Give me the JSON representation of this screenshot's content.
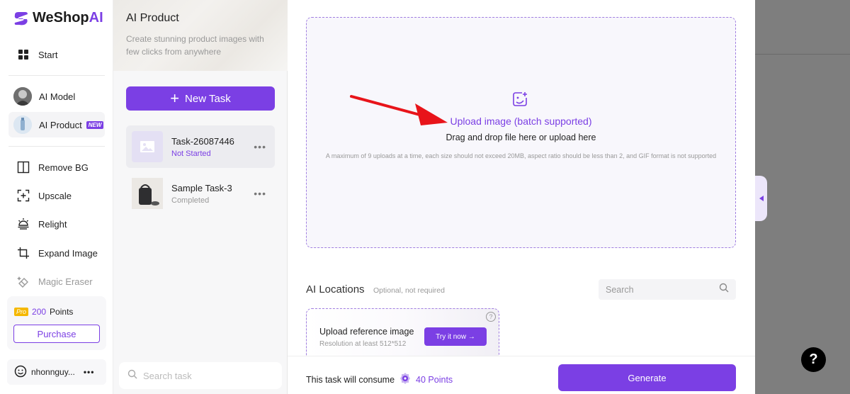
{
  "app": {
    "logo_text": "WeShop",
    "logo_ai": "AI"
  },
  "nav": {
    "start": "Start",
    "ai_model": "AI Model",
    "ai_product": "AI Product",
    "new_badge": "NEW",
    "remove_bg": "Remove BG",
    "upscale": "Upscale",
    "relight": "Relight",
    "expand_image": "Expand Image",
    "magic_eraser": "Magic Eraser"
  },
  "points": {
    "badge": "Pro",
    "amount": "200",
    "unit": "Points",
    "purchase": "Purchase"
  },
  "user": {
    "name": "nhonnguy...",
    "more": "•••"
  },
  "panel": {
    "title": "AI Product",
    "subtitle": "Create stunning product images with few clicks from anywhere",
    "new_task": "New Task",
    "tasks": [
      {
        "name": "Task-26087446",
        "status": "Not Started",
        "status_color": "#7b3fe4"
      },
      {
        "name": "Sample Task-3",
        "status": "Completed",
        "status_color": "#999999"
      }
    ],
    "search_placeholder": "Search task"
  },
  "upload": {
    "title": "Upload image (batch supported)",
    "subtitle": "Drag and drop file here or upload here",
    "note": "A maximum of 9 uploads at a time, each size should not exceed 20MB, aspect ratio should be less than 2, and GIF format is not supported"
  },
  "locations": {
    "title": "AI Locations",
    "optional": "Optional, not required",
    "search_placeholder": "Search",
    "ref_title": "Upload reference image",
    "ref_sub": "Resolution at least 512*512",
    "try_btn": "Try it now →",
    "help": "?"
  },
  "footer": {
    "consume_text": "This task will consume",
    "points": "40 Points",
    "generate": "Generate"
  },
  "help_button": "?",
  "colors": {
    "accent": "#7b3fe4",
    "overlay": "#7e7e7e",
    "arrow": "#e8141a"
  }
}
